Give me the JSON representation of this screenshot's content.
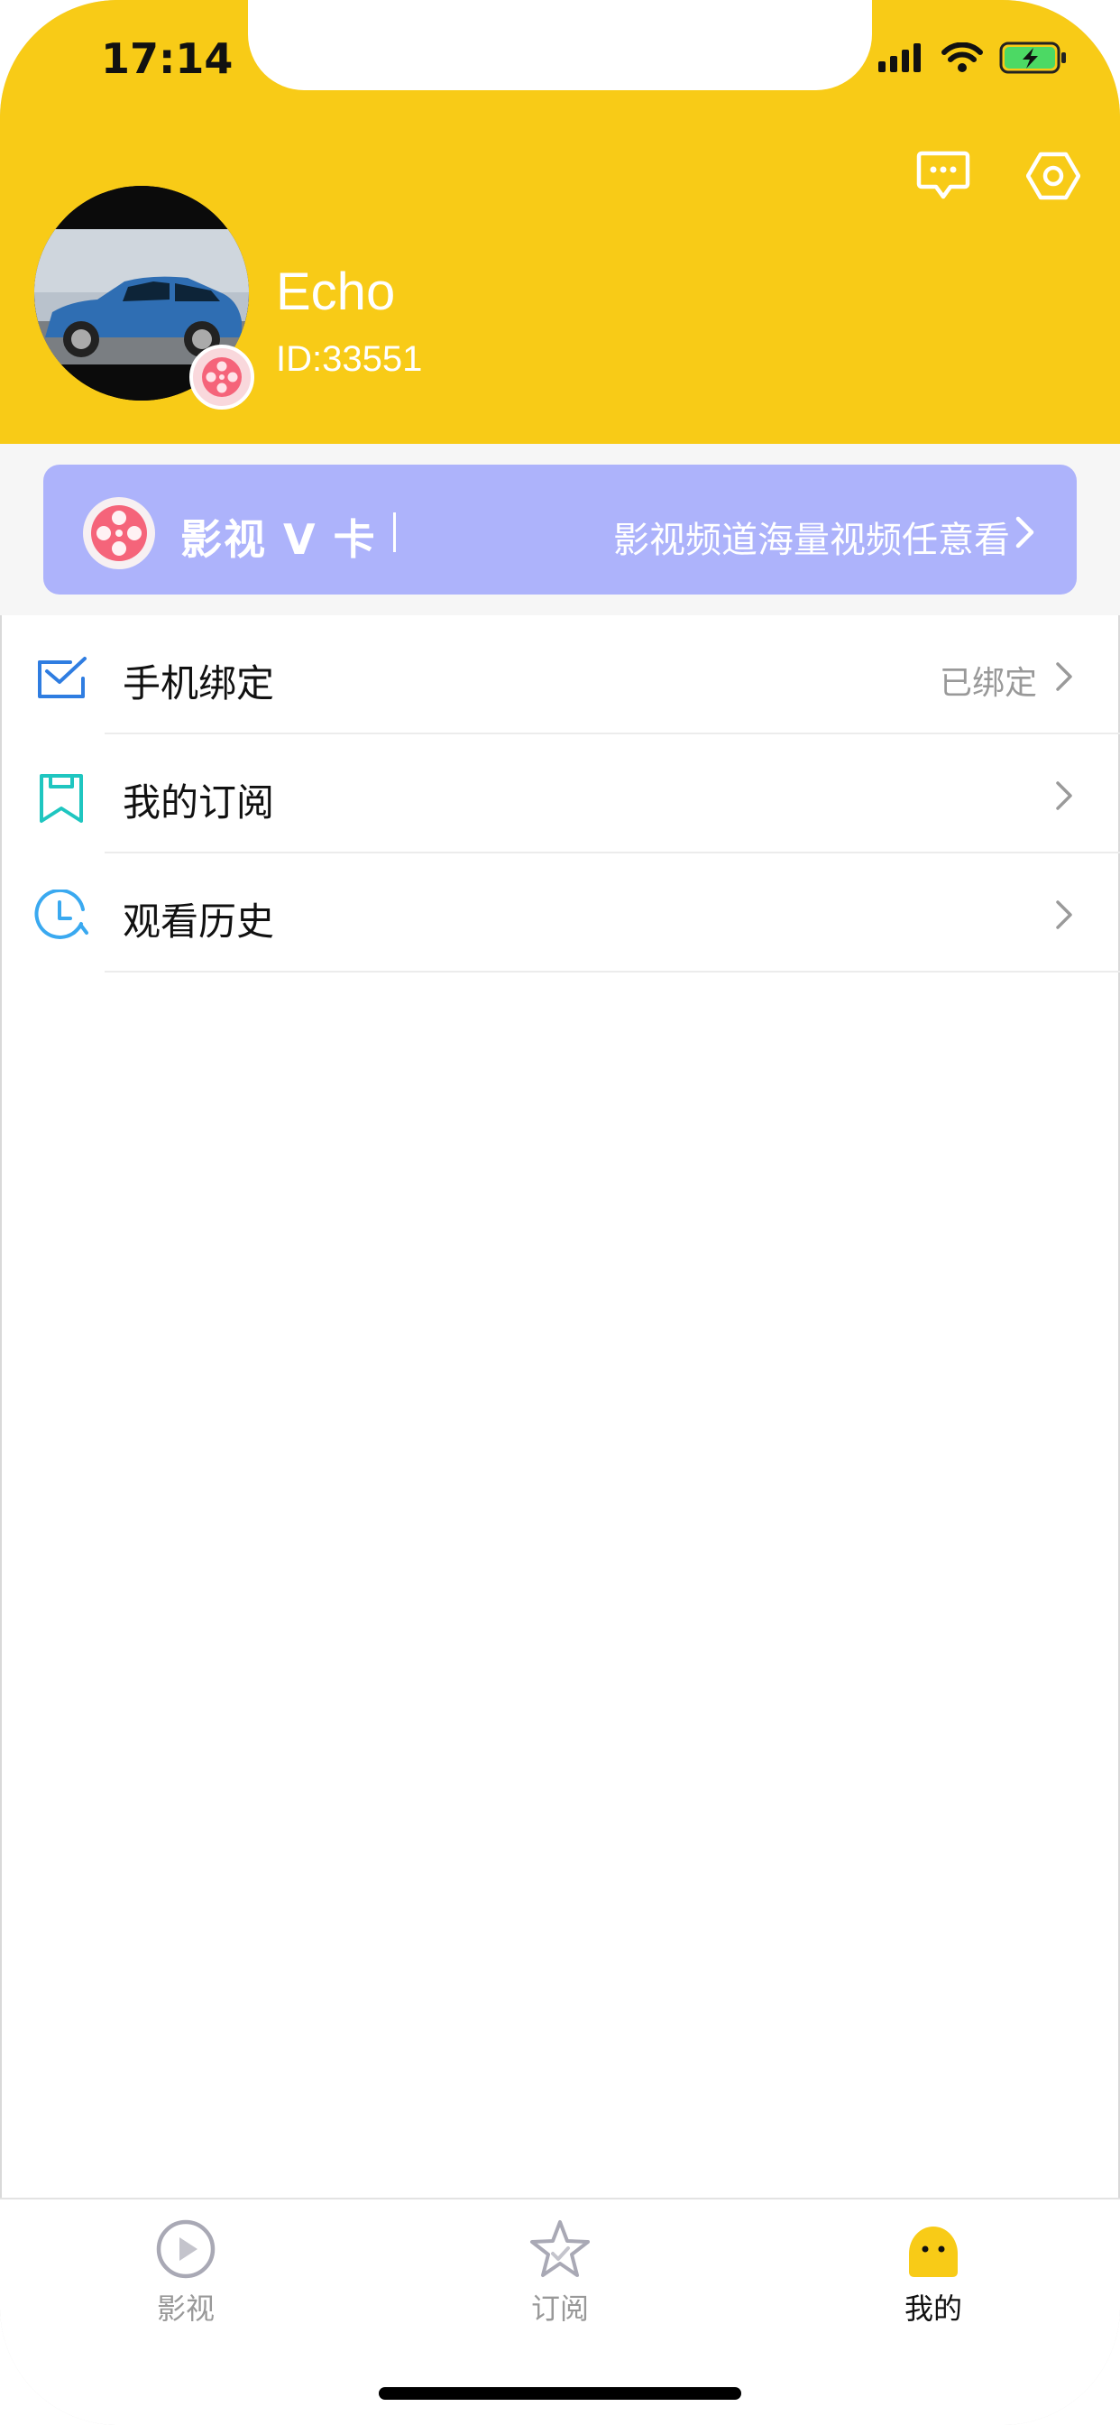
{
  "status_bar": {
    "time": "17:14"
  },
  "profile": {
    "name": "Echo",
    "id_text": "ID:33551"
  },
  "vip_card": {
    "title": "影视 V 卡",
    "description": "影视频道海量视频任意看"
  },
  "menu": [
    {
      "label": "手机绑定",
      "status": "已绑定",
      "icon": "phone-bind-icon"
    },
    {
      "label": "我的订阅",
      "status": "",
      "icon": "bookmark-icon"
    },
    {
      "label": "观看历史",
      "status": "",
      "icon": "clock-history-icon"
    }
  ],
  "tabs": [
    {
      "label": "影视",
      "icon": "play-circle-icon",
      "active": false
    },
    {
      "label": "订阅",
      "icon": "star-icon",
      "active": false
    },
    {
      "label": "我的",
      "icon": "profile-face-icon",
      "active": true
    }
  ],
  "colors": {
    "header": "#f8cb17",
    "vip_card": "#adb3fb",
    "accent_blue": "#2f7de1",
    "accent_teal": "#1fc6c0",
    "accent_cyan": "#3aa9f0"
  }
}
